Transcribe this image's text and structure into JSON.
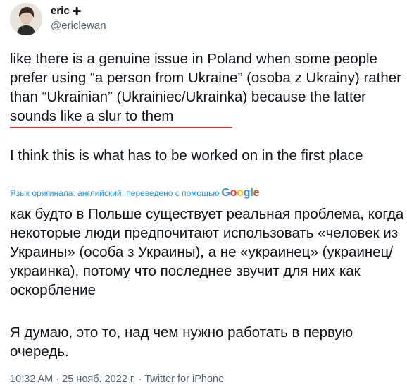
{
  "author": {
    "display_name": "eric",
    "badge_symbol": "✚",
    "handle": "@ericlewan",
    "avatar_icon": "profile-photo"
  },
  "tweet": {
    "original_paragraphs": [
      "like there is a genuine issue in Poland when some people prefer using “a person from Ukraine” (osoba z Ukrainy) rather than “Ukrainian” (Ukrainiec/Ukrainka) because the latter sounds like a slur to them",
      "I think this is what has to be worked on in the first place"
    ],
    "translation_note": "Язык оригинала: английский, переведено с помощью",
    "translation_provider": "Google",
    "translated_paragraphs": [
      "как будто в Польше существует реальная проблема, когда некоторые люди предпочитают использовать «человек из Украины» (особа з Украины), а не «украинец» (украинец/украинка), потому что последнее звучит для них как оскорбление",
      "Я думаю, это то, над чем нужно работать в первую очередь."
    ],
    "timestamp": "10:32 AM · 25 нояб. 2022 г. · Twitter for iPhone"
  },
  "colors": {
    "text": "#0f1419",
    "secondary_text": "#536471",
    "link_blue": "#1d9bf0",
    "underline_red": "#d22f2f"
  }
}
